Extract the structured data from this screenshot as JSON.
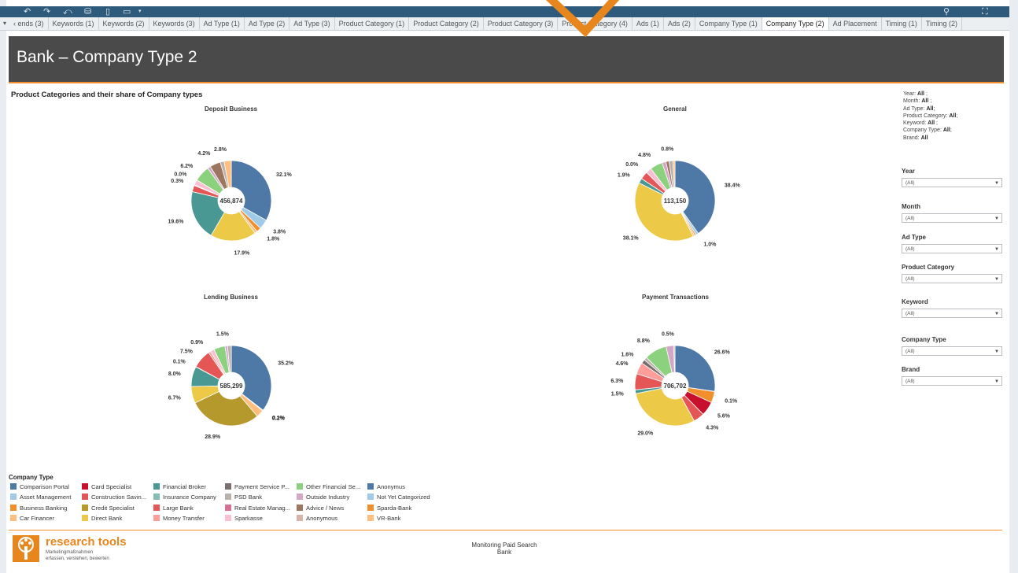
{
  "toolbar": {
    "icons": [
      "undo-icon",
      "redo-icon",
      "revert-icon",
      "data-source-icon",
      "save-icon",
      "present-icon",
      "more-icon",
      "pin-icon",
      "fullscreen-icon"
    ]
  },
  "tabs": {
    "items": [
      {
        "label": "‹ ends (3)",
        "active": false
      },
      {
        "label": "Keywords (1)",
        "active": false
      },
      {
        "label": "Keywords (2)",
        "active": false
      },
      {
        "label": "Keywords (3)",
        "active": false
      },
      {
        "label": "Ad Type (1)",
        "active": false
      },
      {
        "label": "Ad Type (2)",
        "active": false
      },
      {
        "label": "Ad Type (3)",
        "active": false
      },
      {
        "label": "Product Category (1)",
        "active": false
      },
      {
        "label": "Product Category (2)",
        "active": false
      },
      {
        "label": "Product Category (3)",
        "active": false
      },
      {
        "label": "Product Category (4)",
        "active": false
      },
      {
        "label": "Ads (1)",
        "active": false
      },
      {
        "label": "Ads (2)",
        "active": false
      },
      {
        "label": "Company Type (1)",
        "active": false
      },
      {
        "label": "Company Type (2)",
        "active": true
      },
      {
        "label": "Ad Placement",
        "active": false
      },
      {
        "label": "Timing (1)",
        "active": false
      },
      {
        "label": "Timing (2)",
        "active": false
      }
    ]
  },
  "header": {
    "title": "Bank – Company Type 2"
  },
  "section_title": "Product Categories and their share of Company types",
  "filters_summary": {
    "lines": [
      {
        "label": "Year:",
        "value": "All",
        "tail": " ;"
      },
      {
        "label": "Month:",
        "value": "All",
        "tail": " ;"
      },
      {
        "label": "Ad Type:",
        "value": "All",
        "tail": ";"
      },
      {
        "label": "Product Category:",
        "value": "All",
        "tail": ";"
      },
      {
        "label": "Keyword:",
        "value": "All",
        "tail": " ;"
      },
      {
        "label": "Company Type:",
        "value": "All",
        "tail": ";"
      },
      {
        "label": "Brand:",
        "value": "All",
        "tail": ""
      }
    ]
  },
  "filters": [
    {
      "label": "Year",
      "value": "(All)"
    },
    {
      "label": "Month",
      "value": "(All)"
    },
    {
      "label": "Ad Type",
      "value": "(All)"
    },
    {
      "label": "Product Category",
      "value": "(All)"
    },
    {
      "label": "Keyword",
      "value": "(All)"
    },
    {
      "label": "Company Type",
      "value": "(All)"
    },
    {
      "label": "Brand",
      "value": "(All)"
    }
  ],
  "legend": {
    "title": "Company Type",
    "items": [
      {
        "label": "Comparison Portal",
        "color": "#4e79a7"
      },
      {
        "label": "Asset Management",
        "color": "#a0cbe8"
      },
      {
        "label": "Business Banking",
        "color": "#f28e2b"
      },
      {
        "label": "Car Financer",
        "color": "#ffbe7d"
      },
      {
        "label": "Card Specialist",
        "color": "#c8102e"
      },
      {
        "label": "Construction Savin...",
        "color": "#e15759"
      },
      {
        "label": "Credit Specialist",
        "color": "#b6992d"
      },
      {
        "label": "Direct Bank",
        "color": "#edc948"
      },
      {
        "label": "Financial Broker",
        "color": "#499894"
      },
      {
        "label": "Insurance Company",
        "color": "#86bcb6"
      },
      {
        "label": "Large Bank",
        "color": "#e45756"
      },
      {
        "label": "Money Transfer",
        "color": "#ff9d9a"
      },
      {
        "label": "Payment Service P...",
        "color": "#79706e"
      },
      {
        "label": "PSD Bank",
        "color": "#bab0ac"
      },
      {
        "label": "Real Estate Manag...",
        "color": "#d37295"
      },
      {
        "label": "Sparkasse",
        "color": "#fabfd2"
      },
      {
        "label": "Other Financial Se...",
        "color": "#8cd17d"
      },
      {
        "label": "Outside Industry",
        "color": "#d4a6c8"
      },
      {
        "label": "Advice / News",
        "color": "#9d7660"
      },
      {
        "label": "Anonymous",
        "color": "#d7b5a6"
      },
      {
        "label": "Anonymus",
        "color": "#4e79a7"
      },
      {
        "label": "Not Yet Categorized",
        "color": "#a0cbe8"
      },
      {
        "label": "Sparda-Bank",
        "color": "#f28e2b"
      },
      {
        "label": "VR-Bank",
        "color": "#ffbe7d"
      }
    ]
  },
  "chart_data": [
    {
      "type": "pie",
      "title": "Deposit Business",
      "total": "456,874",
      "slices": [
        {
          "name": "Comparison Portal",
          "value": 32.1,
          "color": "#4e79a7",
          "label": "32.1%"
        },
        {
          "name": "Asset Management",
          "value": 3.8,
          "color": "#a0cbe8",
          "label": "3.8%"
        },
        {
          "name": "Business Banking",
          "value": 1.8,
          "color": "#f28e2b",
          "label": "1.8%"
        },
        {
          "name": "Car Financer",
          "value": 1.0,
          "color": "#ffbe7d",
          "label": ""
        },
        {
          "name": "Direct Bank",
          "value": 17.9,
          "color": "#edc948",
          "label": "17.9%"
        },
        {
          "name": "Financial Broker",
          "value": 19.6,
          "color": "#499894",
          "label": "19.6%"
        },
        {
          "name": "Large Bank",
          "value": 2.5,
          "color": "#e45756",
          "label": ""
        },
        {
          "name": "Money Transfer",
          "value": 0.3,
          "color": "#ff9d9a",
          "label": "0.3%"
        },
        {
          "name": "Sparkasse",
          "value": 2.0,
          "color": "#fabfd2",
          "label": ""
        },
        {
          "name": "Real Estate Manag...",
          "value": 0.01,
          "color": "#d37295",
          "label": "0.0%"
        },
        {
          "name": "Other Financial Se...",
          "value": 6.2,
          "color": "#8cd17d",
          "label": "6.2%"
        },
        {
          "name": "Outside Industry",
          "value": 1.2,
          "color": "#d4a6c8",
          "label": ""
        },
        {
          "name": "Advice / News",
          "value": 4.2,
          "color": "#9d7660",
          "label": "4.2%"
        },
        {
          "name": "PSD Bank",
          "value": 1.5,
          "color": "#bab0ac",
          "label": ""
        },
        {
          "name": "Anonymous",
          "value": 2.8,
          "color": "#ffbe7d",
          "label": "2.8%"
        }
      ]
    },
    {
      "type": "pie",
      "title": "General",
      "total": "113,150",
      "slices": [
        {
          "name": "Comparison Portal",
          "value": 38.4,
          "color": "#4e79a7",
          "label": "38.4%"
        },
        {
          "name": "Asset Management",
          "value": 1.0,
          "color": "#a0cbe8",
          "label": "1.0%"
        },
        {
          "name": "Business Banking",
          "value": 0.6,
          "color": "#f28e2b",
          "label": ""
        },
        {
          "name": "Car Financer",
          "value": 0.6,
          "color": "#ffbe7d",
          "label": ""
        },
        {
          "name": "Direct Bank",
          "value": 38.1,
          "color": "#edc948",
          "label": "38.1%"
        },
        {
          "name": "Financial Broker",
          "value": 1.9,
          "color": "#499894",
          "label": "1.9%"
        },
        {
          "name": "Large Bank",
          "value": 3.0,
          "color": "#e45756",
          "label": ""
        },
        {
          "name": "Real Estate Manag...",
          "value": 0.01,
          "color": "#d37295",
          "label": "0.0%"
        },
        {
          "name": "Sparkasse",
          "value": 2.2,
          "color": "#fabfd2",
          "label": ""
        },
        {
          "name": "Other Financial Se...",
          "value": 4.8,
          "color": "#8cd17d",
          "label": "4.8%"
        },
        {
          "name": "Outside Industry",
          "value": 1.5,
          "color": "#d4a6c8",
          "label": ""
        },
        {
          "name": "Advice / News",
          "value": 1.2,
          "color": "#9d7660",
          "label": ""
        },
        {
          "name": "PSD Bank",
          "value": 1.5,
          "color": "#bab0ac",
          "label": ""
        },
        {
          "name": "Car Financer ",
          "value": 0.8,
          "color": "#ffbe7d",
          "label": "0.8%"
        }
      ]
    },
    {
      "type": "pie",
      "title": "Lending Business",
      "total": "585,299",
      "slices": [
        {
          "name": "Comparison Portal",
          "value": 35.2,
          "color": "#4e79a7",
          "label": "35.2%"
        },
        {
          "name": "Asset Management",
          "value": 0.1,
          "color": "#a0cbe8",
          "label": "0.1%"
        },
        {
          "name": "Business Banking",
          "value": 0.2,
          "color": "#f28e2b",
          "label": "0.2%"
        },
        {
          "name": "Car Financer",
          "value": 3.0,
          "color": "#ffbe7d",
          "label": ""
        },
        {
          "name": "Credit Specialist",
          "value": 28.9,
          "color": "#b6992d",
          "label": "28.9%"
        },
        {
          "name": "Direct Bank",
          "value": 6.7,
          "color": "#edc948",
          "label": "6.7%"
        },
        {
          "name": "Financial Broker",
          "value": 8.0,
          "color": "#499894",
          "label": "8.0%"
        },
        {
          "name": "Card Specialist",
          "value": 0.1,
          "color": "#c8102e",
          "label": "0.1%"
        },
        {
          "name": "Large Bank",
          "value": 7.5,
          "color": "#e45756",
          "label": "7.5%"
        },
        {
          "name": "Money Transfer",
          "value": 0.9,
          "color": "#ff9d9a",
          "label": "0.9%"
        },
        {
          "name": "Sparkasse",
          "value": 1.6,
          "color": "#fabfd2",
          "label": ""
        },
        {
          "name": "Other Financial Se...",
          "value": 4.5,
          "color": "#8cd17d",
          "label": ""
        },
        {
          "name": "Outside Industry",
          "value": 1.0,
          "color": "#d4a6c8",
          "label": ""
        },
        {
          "name": "PSD Bank",
          "value": 1.5,
          "color": "#bab0ac",
          "label": "1.5%"
        }
      ]
    },
    {
      "type": "pie",
      "title": "Payment Transactions",
      "total": "706,702",
      "slices": [
        {
          "name": "Comparison Portal",
          "value": 26.6,
          "color": "#4e79a7",
          "label": "26.6%"
        },
        {
          "name": "Business Banking",
          "value": 0.1,
          "color": "#f28e2b",
          "label": ""
        },
        {
          "name": "Car Financer",
          "value": 4.4,
          "color": "#f28e2b",
          "label": "0.1%"
        },
        {
          "name": "Card Specialist",
          "value": 5.6,
          "color": "#c8102e",
          "label": "5.6%"
        },
        {
          "name": "Large Bank",
          "value": 4.3,
          "color": "#e45756",
          "label": "4.3%"
        },
        {
          "name": "Direct Bank",
          "value": 29.0,
          "color": "#edc948",
          "label": "29.0%"
        },
        {
          "name": "Financial Broker",
          "value": 1.5,
          "color": "#499894",
          "label": "1.5%"
        },
        {
          "name": "Large Bank ",
          "value": 6.3,
          "color": "#e45756",
          "label": "6.3%"
        },
        {
          "name": "Money Transfer",
          "value": 4.6,
          "color": "#ff9d9a",
          "label": "4.6%"
        },
        {
          "name": "Payment Service P...",
          "value": 1.6,
          "color": "#79706e",
          "label": "1.6%"
        },
        {
          "name": "PSD Bank",
          "value": 1.2,
          "color": "#bab0ac",
          "label": ""
        },
        {
          "name": "Other Financial Se...",
          "value": 8.8,
          "color": "#8cd17d",
          "label": "8.8%"
        },
        {
          "name": "Outside Industry",
          "value": 3.0,
          "color": "#d4a6c8",
          "label": ""
        },
        {
          "name": "Anonymous",
          "value": 0.5,
          "color": "#d7b5a6",
          "label": "0.5%"
        }
      ]
    }
  ],
  "footer": {
    "logo_name": "research tools",
    "logo_tagline_1": "Marketingmaßnahmen",
    "logo_tagline_2": "erfassen, verstehen, bewerten",
    "center_line_1": "Monitoring Paid Search",
    "center_line_2": "Bank"
  }
}
